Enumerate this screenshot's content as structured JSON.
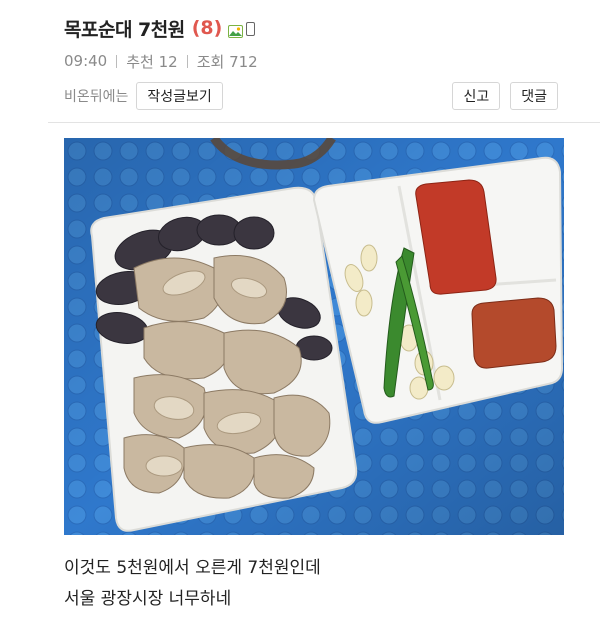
{
  "post": {
    "title": "목포순대 7천원",
    "comment_count": "(8)",
    "time": "09:40",
    "recommend": "추천 12",
    "views": "조회 712",
    "author": "비온뒤에는",
    "view_posts_button": "작성글보기",
    "report_button": "신고",
    "comment_button": "댓글",
    "caption_line1": "이것도 5천원에서 오른게 7천원인데",
    "caption_line2": "서울 광장시장 너무하네"
  },
  "icons": [
    "image-icon",
    "mobile-icon"
  ],
  "colors": {
    "comment_count": "#e0584f",
    "meta_text": "#8a8a8a",
    "table_blue": "#2f78cc"
  }
}
